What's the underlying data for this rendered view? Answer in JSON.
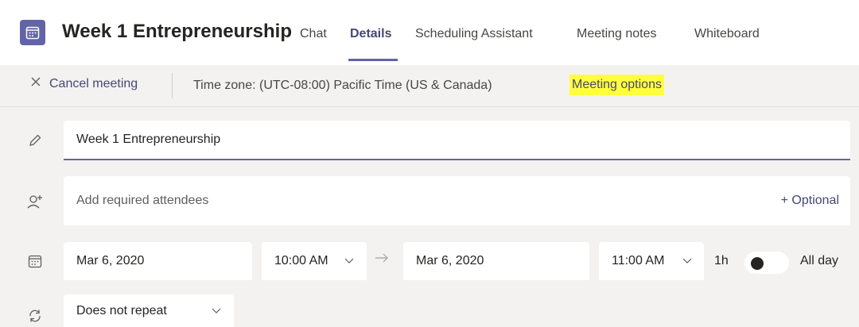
{
  "header": {
    "title": "Week 1 Entrepreneurship",
    "tabs": [
      {
        "label": "Chat",
        "active": false
      },
      {
        "label": "Details",
        "active": true
      },
      {
        "label": "Scheduling Assistant",
        "active": false
      },
      {
        "label": "Meeting notes",
        "active": false
      },
      {
        "label": "Whiteboard",
        "active": false
      }
    ],
    "app_icon": "calendar-icon"
  },
  "toolbar": {
    "cancel_label": "Cancel meeting",
    "cancel_icon": "close-icon",
    "time_zone": "Time zone: (UTC-08:00) Pacific Time (US & Canada)",
    "meeting_options_label": "Meeting options",
    "highlight_color": "#ffff3d"
  },
  "form": {
    "title_value": "Week 1 Entrepreneurship",
    "attendees_placeholder": "Add required attendees",
    "optional_label": "+ Optional",
    "start_date": "Mar 6, 2020",
    "start_time": "10:00 AM",
    "end_date": "Mar 6, 2020",
    "end_time": "11:00 AM",
    "duration": "1h",
    "all_day_label": "All day",
    "all_day_on": false,
    "repeat_value": "Does not repeat"
  },
  "colors": {
    "accent": "#6264a7",
    "accent_text": "#464775",
    "background": "#f3f2f1"
  }
}
